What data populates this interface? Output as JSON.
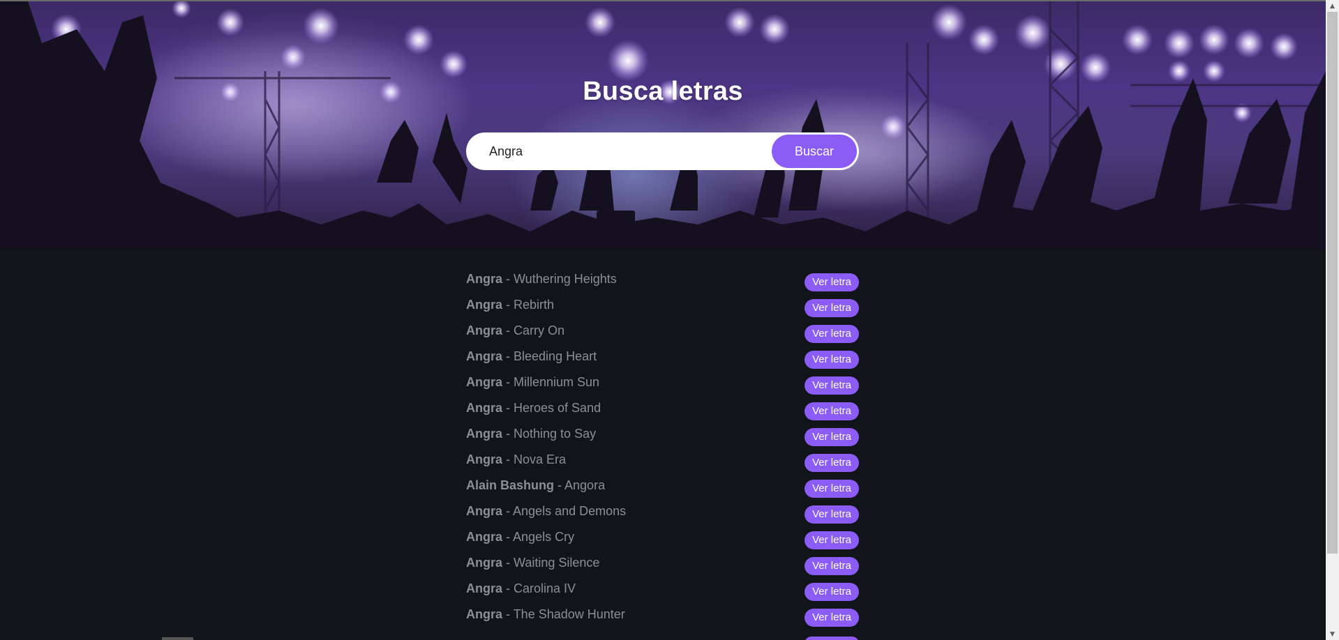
{
  "hero": {
    "title": "Busca letras"
  },
  "search": {
    "value": "Angra",
    "button_label": "Buscar"
  },
  "results": [
    {
      "artist": "Angra",
      "title": "Wuthering Heights"
    },
    {
      "artist": "Angra",
      "title": "Rebirth"
    },
    {
      "artist": "Angra",
      "title": "Carry On"
    },
    {
      "artist": "Angra",
      "title": "Bleeding Heart"
    },
    {
      "artist": "Angra",
      "title": "Millennium Sun"
    },
    {
      "artist": "Angra",
      "title": "Heroes of Sand"
    },
    {
      "artist": "Angra",
      "title": "Nothing to Say"
    },
    {
      "artist": "Angra",
      "title": "Nova Era"
    },
    {
      "artist": "Alain Bashung",
      "title": "Angora"
    },
    {
      "artist": "Angra",
      "title": "Angels and Demons"
    },
    {
      "artist": "Angra",
      "title": "Angels Cry"
    },
    {
      "artist": "Angra",
      "title": "Waiting Silence"
    },
    {
      "artist": "Angra",
      "title": "Carolina IV"
    },
    {
      "artist": "Angra",
      "title": "The Shadow Hunter"
    }
  ],
  "separator": " - ",
  "view_button_label": "Ver letra",
  "colors": {
    "accent": "#8b5cf6",
    "page_background": "#111419",
    "result_text": "#8d8f95"
  },
  "icons": {
    "scroll_up": "▲",
    "scroll_down": "▼"
  }
}
